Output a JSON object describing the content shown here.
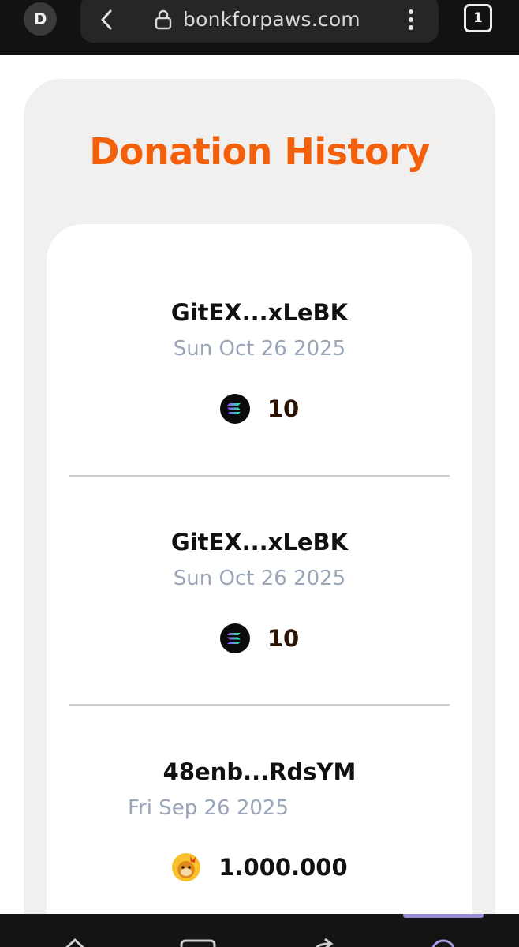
{
  "browser": {
    "profile_initial": "D",
    "url": "bonkforpaws.com",
    "tab_count": "1"
  },
  "page": {
    "title": "Donation History"
  },
  "donations": [
    {
      "address": "GitEX...xLeBK",
      "date": "Sun Oct 26 2025",
      "amount": "10",
      "token_icon": "solana-icon"
    },
    {
      "address": "GitEX...xLeBK",
      "date": "Sun Oct 26 2025",
      "amount": "10",
      "token_icon": "solana-icon"
    },
    {
      "address": "48enb...RdsYM",
      "date": "Fri Sep 26 2025",
      "amount": "1.000.000",
      "token_icon": "bonk-icon"
    }
  ],
  "colors": {
    "accent": "#f2600c",
    "panel": "#f2f0ef",
    "date_text": "#9aa6b8"
  },
  "bottom_nav": {
    "icons": [
      "home-icon",
      "tabs-icon",
      "share-icon",
      "search-icon"
    ]
  }
}
